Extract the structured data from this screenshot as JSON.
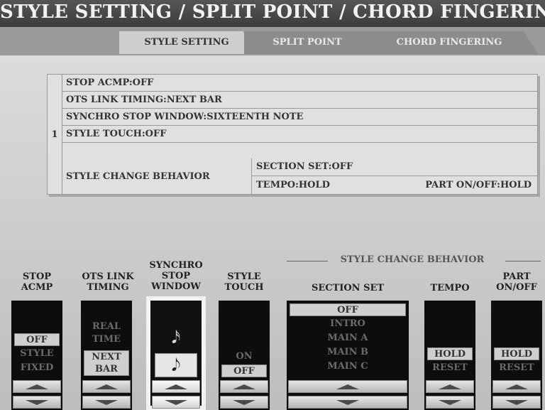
{
  "header": {
    "title": "STYLE SETTING / SPLIT POINT / CHORD FINGERING"
  },
  "tabs": [
    {
      "label": "STYLE SETTING",
      "active": true
    },
    {
      "label": "SPLIT POINT",
      "active": false
    },
    {
      "label": "CHORD FINGERING",
      "active": false
    }
  ],
  "summary": {
    "index": "1",
    "rows": [
      "STOP ACMP:OFF",
      "OTS LINK TIMING:NEXT BAR",
      "SYNCHRO STOP WINDOW:SIXTEENTH NOTE",
      "STYLE TOUCH:OFF"
    ],
    "change_behavior": {
      "label": "STYLE CHANGE BEHAVIOR",
      "section_set": "SECTION SET:OFF",
      "tempo": "TEMPO:HOLD",
      "part": "PART ON/OFF:HOLD"
    }
  },
  "controls": {
    "group_header": "STYLE CHANGE BEHAVIOR",
    "stop_acmp": {
      "label_1": "STOP",
      "label_2": "ACMP",
      "options": [
        "OFF",
        "STYLE",
        "FIXED"
      ]
    },
    "ots_link": {
      "label_1": "OTS LINK",
      "label_2": "TIMING",
      "options": [
        "REAL",
        "TIME",
        "NEXT",
        "BAR"
      ]
    },
    "synchro": {
      "label_1": "SYNCHRO",
      "label_2": "STOP",
      "label_3": "WINDOW",
      "note_1": "𝅘𝅥𝅯",
      "note_2": "𝅘𝅥𝅮"
    },
    "style_touch": {
      "label_1": "STYLE",
      "label_2": "TOUCH",
      "options": [
        "ON",
        "OFF"
      ]
    },
    "section_set": {
      "label": "SECTION SET",
      "options": [
        "OFF",
        "INTRO",
        "MAIN A",
        "MAIN B",
        "MAIN C"
      ]
    },
    "tempo": {
      "label": "TEMPO",
      "options": [
        "HOLD",
        "RESET"
      ]
    },
    "part": {
      "label_1": "PART",
      "label_2": "ON/OFF",
      "options": [
        "HOLD",
        "RESET"
      ]
    }
  }
}
